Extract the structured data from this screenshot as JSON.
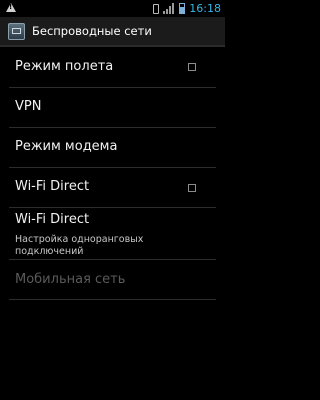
{
  "status_bar": {
    "time": "16:18",
    "icons": [
      "warning-icon",
      "sim-card-icon",
      "signal-icon",
      "battery-icon"
    ]
  },
  "action_bar": {
    "title": "Беспроводные сети",
    "icon": "settings-app-icon"
  },
  "list": {
    "items": [
      {
        "label": "Режим полета",
        "has_checkbox": true,
        "checked": false,
        "enabled": true
      },
      {
        "label": "VPN",
        "has_checkbox": false,
        "enabled": true
      },
      {
        "label": "Режим модема",
        "has_checkbox": false,
        "enabled": true
      },
      {
        "label": "Wi-Fi Direct",
        "has_checkbox": true,
        "checked": false,
        "enabled": true
      },
      {
        "label": "Wi-Fi Direct",
        "summary": "Настройка одноранговых подключений",
        "has_checkbox": false,
        "enabled": true
      },
      {
        "label": "Мобильная сеть",
        "has_checkbox": false,
        "enabled": false
      }
    ]
  },
  "colors": {
    "background": "#000000",
    "clock": "#33b5e5",
    "disabled_text": "#5a5a5a"
  }
}
